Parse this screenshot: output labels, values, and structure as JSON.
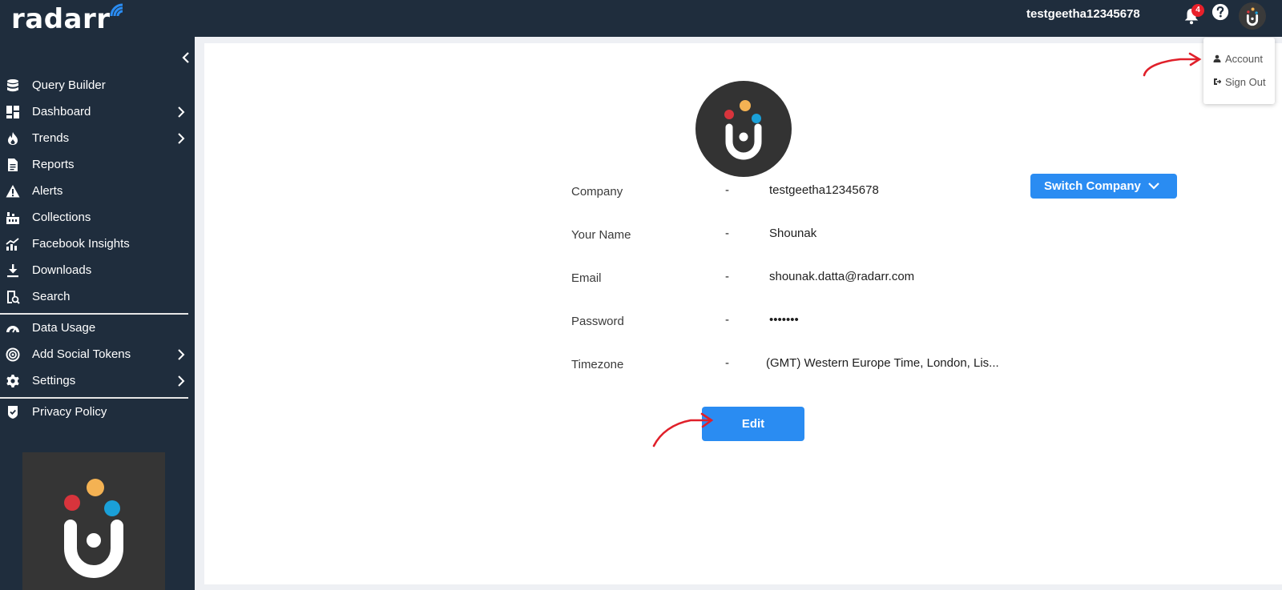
{
  "app": {
    "logo_text": "radarr",
    "username": "testgeetha12345678",
    "notification_count": "4",
    "brand_color": "#1f2d3d",
    "accent_color": "#2a8cf2"
  },
  "sidebar": {
    "groups": [
      [
        {
          "label": "Query Builder",
          "icon": "database-icon",
          "has_submenu": false
        },
        {
          "label": "Dashboard",
          "icon": "dashboard-icon",
          "has_submenu": true
        },
        {
          "label": "Trends",
          "icon": "flame-icon",
          "has_submenu": true
        },
        {
          "label": "Reports",
          "icon": "document-icon",
          "has_submenu": false
        },
        {
          "label": "Alerts",
          "icon": "warning-icon",
          "has_submenu": false
        },
        {
          "label": "Collections",
          "icon": "collections-icon",
          "has_submenu": false
        },
        {
          "label": "Facebook Insights",
          "icon": "chart-icon",
          "has_submenu": false
        },
        {
          "label": "Downloads",
          "icon": "download-icon",
          "has_submenu": false
        },
        {
          "label": "Search",
          "icon": "search-doc-icon",
          "has_submenu": false
        }
      ],
      [
        {
          "label": "Data Usage",
          "icon": "gauge-icon",
          "has_submenu": false
        },
        {
          "label": "Add Social Tokens",
          "icon": "target-icon",
          "has_submenu": true
        },
        {
          "label": "Settings",
          "icon": "gear-icon",
          "has_submenu": true
        }
      ],
      [
        {
          "label": "Privacy Policy",
          "icon": "shield-icon",
          "has_submenu": false
        }
      ]
    ]
  },
  "profile": {
    "fields": [
      {
        "label": "Company",
        "separator": "-",
        "value": "testgeetha12345678"
      },
      {
        "label": "Your Name",
        "separator": "-",
        "value": "Shounak"
      },
      {
        "label": "Email",
        "separator": "-",
        "value": "shounak.datta@radarr.com"
      },
      {
        "label": "Password",
        "separator": "-",
        "value": "•••••••"
      },
      {
        "label": "Timezone",
        "separator": "-",
        "value": "(GMT) Western Europe Time, London, Lis..."
      }
    ],
    "switch_company_label": "Switch Company",
    "edit_label": "Edit"
  },
  "user_menu": {
    "items": [
      {
        "label": "Account",
        "icon": "user-icon"
      },
      {
        "label": "Sign Out",
        "icon": "sign-out-icon"
      }
    ]
  }
}
